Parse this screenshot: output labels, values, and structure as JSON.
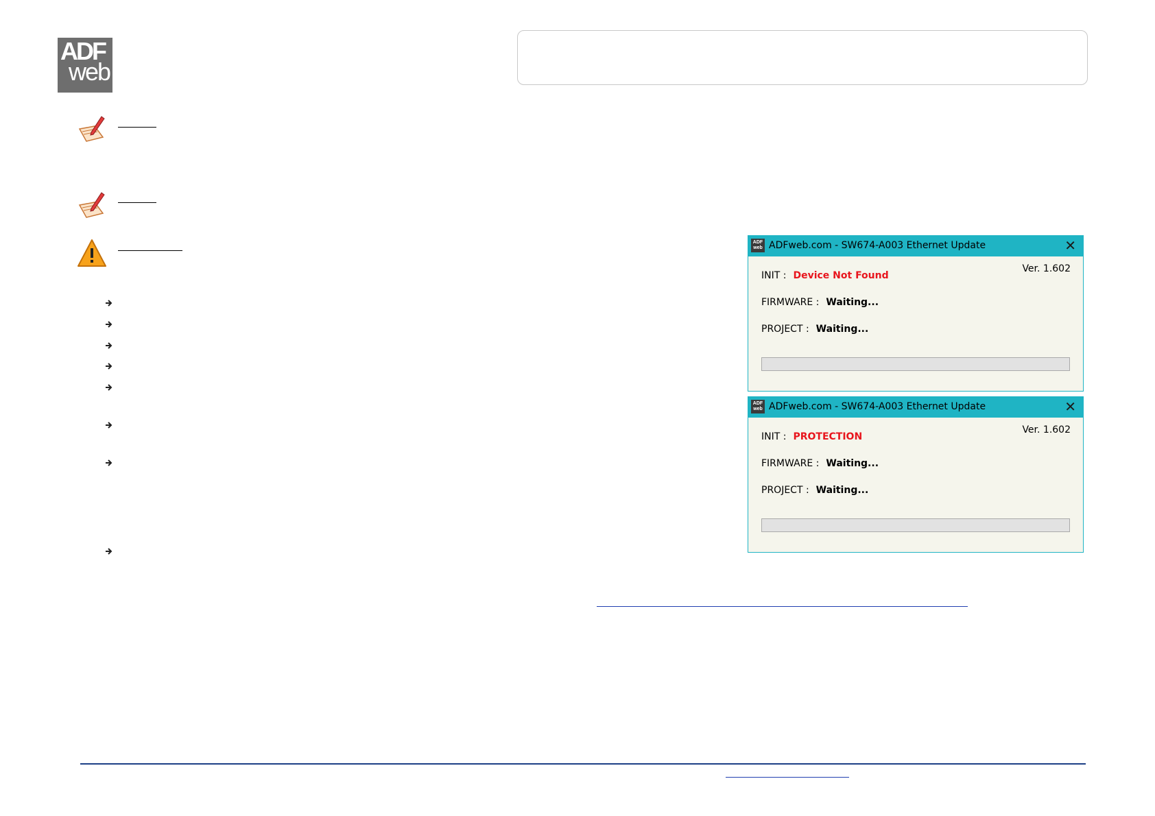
{
  "logo": {
    "line1": "ADF",
    "line2": "web"
  },
  "windows": [
    {
      "title": "ADFweb.com - SW674-A003 Ethernet Update",
      "close": "✕",
      "version": "Ver. 1.602",
      "init_label": "INIT :",
      "init_value": "Device Not Found",
      "firmware_label": "FIRMWARE :",
      "firmware_value": "Waiting...",
      "project_label": "PROJECT :",
      "project_value": "Waiting...",
      "progress": 0
    },
    {
      "title": "ADFweb.com - SW674-A003 Ethernet Update",
      "close": "✕",
      "version": "Ver. 1.602",
      "init_label": "INIT :",
      "init_value": "PROTECTION",
      "firmware_label": "FIRMWARE :",
      "firmware_value": "Waiting...",
      "project_label": "PROJECT :",
      "project_value": "Waiting...",
      "progress": 0
    }
  ],
  "colors": {
    "titlebar": "#1fb4c4",
    "window_bg": "#f5f5ec",
    "error_text": "#e8151d",
    "footer_rule": "#1c3f86",
    "link": "#1f3fb0"
  }
}
